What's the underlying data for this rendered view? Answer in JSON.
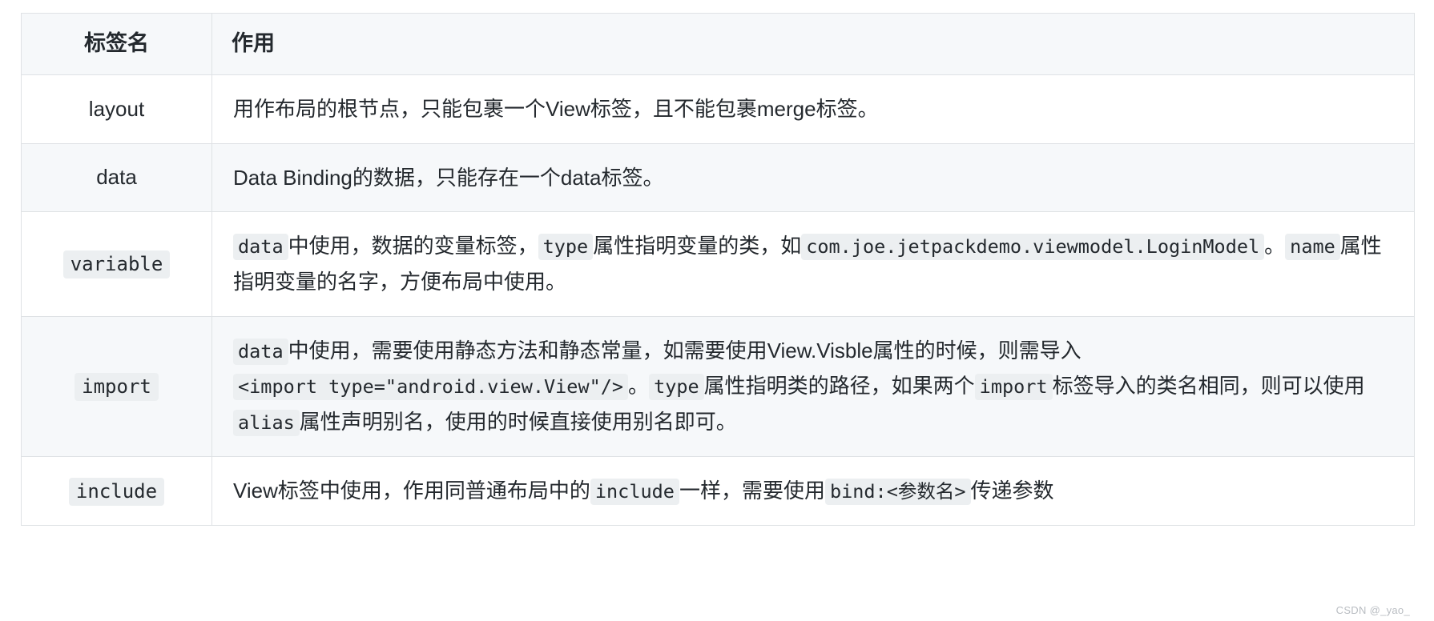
{
  "table": {
    "headers": {
      "tag_name": "标签名",
      "usage": "作用"
    },
    "rows": [
      {
        "tag": "layout",
        "tag_is_code": false,
        "parts": [
          {
            "type": "text",
            "value": "用作布局的根节点，只能包裹一个View标签，且不能包裹merge标签。"
          }
        ]
      },
      {
        "tag": "data",
        "tag_is_code": false,
        "parts": [
          {
            "type": "text",
            "value": "Data Binding的数据，只能存在一个data标签。"
          }
        ]
      },
      {
        "tag": "variable",
        "tag_is_code": true,
        "parts": [
          {
            "type": "code",
            "value": "data"
          },
          {
            "type": "text",
            "value": "中使用，数据的变量标签，"
          },
          {
            "type": "code",
            "value": "type"
          },
          {
            "type": "text",
            "value": "属性指明变量的类，如"
          },
          {
            "type": "code",
            "value": "com.joe.jetpackdemo.viewmodel.LoginModel"
          },
          {
            "type": "text",
            "value": "。"
          },
          {
            "type": "code",
            "value": "name"
          },
          {
            "type": "text",
            "value": "属性指明变量的名字，方便布局中使用。"
          }
        ]
      },
      {
        "tag": "import",
        "tag_is_code": true,
        "parts": [
          {
            "type": "code",
            "value": "data"
          },
          {
            "type": "text",
            "value": "中使用，需要使用静态方法和静态常量，如需要使用View.Visble属性的时候，则需导入"
          },
          {
            "type": "code",
            "value": "<import type=\"android.view.View\"/>"
          },
          {
            "type": "text",
            "value": "。"
          },
          {
            "type": "code",
            "value": "type"
          },
          {
            "type": "text",
            "value": "属性指明类的路径，如果两个"
          },
          {
            "type": "code",
            "value": "import"
          },
          {
            "type": "text",
            "value": "标签导入的类名相同，则可以使用"
          },
          {
            "type": "code",
            "value": "alias"
          },
          {
            "type": "text",
            "value": "属性声明别名，使用的时候直接使用别名即可。"
          }
        ]
      },
      {
        "tag": "include",
        "tag_is_code": true,
        "parts": [
          {
            "type": "text",
            "value": "View标签中使用，作用同普通布局中的"
          },
          {
            "type": "code",
            "value": "include"
          },
          {
            "type": "text",
            "value": "一样，需要使用"
          },
          {
            "type": "code",
            "value": "bind:<参数名>"
          },
          {
            "type": "text",
            "value": "传递参数"
          }
        ]
      }
    ]
  },
  "watermark": "CSDN @_yao_"
}
